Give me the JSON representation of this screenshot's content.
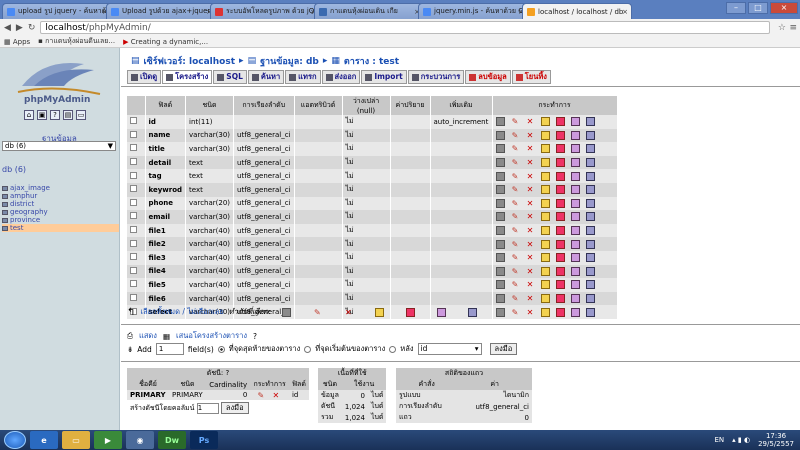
{
  "browser": {
    "tabs": [
      {
        "label": "upload รูป jquery - ค้นหาด้"
      },
      {
        "label": "Upload รูปด้วย ajax+jquer"
      },
      {
        "label": "ระบบอัพโหลดรูปภาพ ด้วย jQ"
      },
      {
        "label": "กาแดนหุ้งผ่อนเดิน เกีย"
      },
      {
        "label": "jquery.min.js - ค้นหาด้วย G"
      },
      {
        "label": "localhost / localhost / db"
      }
    ],
    "url_host": "localhost",
    "url_path": "/phpMyAdmin/",
    "bookmarks": [
      "Apps",
      "กาแดนหุ้งผ่อนดีนเลย...",
      "Creating a dynamic,..."
    ]
  },
  "sidebar": {
    "logo_text": "phpMyAdmin",
    "db_label": "ฐานข้อมูล",
    "db_select": "db (6)",
    "db_heading": "db (6)",
    "tables": [
      "ajax_image",
      "amphur",
      "district",
      "geography",
      "province",
      "test"
    ]
  },
  "breadcrumb": {
    "server": "เซิร์ฟเวอร์: localhost",
    "database": "ฐานข้อมูล: db",
    "table": "ตาราง : test"
  },
  "toolbar": {
    "browse": "เปิดดู",
    "structure": "โครงสร้าง",
    "sql": "SQL",
    "search": "ค้นหา",
    "insert": "แทรก",
    "export": "ส่งออก",
    "import": "Import",
    "operations": "กระบวนการ",
    "empty": "ลบข้อมูล",
    "drop": "โยนทิ้ง"
  },
  "structure": {
    "headers": [
      "ฟิลด์",
      "ชนิด",
      "การเรียงลำดับ",
      "แอตทริบิวต์",
      "ว่างเปล่า (null)",
      "ค่าปริยาย",
      "เพิ่มเติม",
      "กระทำการ"
    ],
    "rows": [
      {
        "field": "id",
        "type": "int(11)",
        "collation": "",
        "null": "ไม่",
        "extra": "auto_increment"
      },
      {
        "field": "name",
        "type": "varchar(30)",
        "collation": "utf8_general_ci",
        "null": "ไม่",
        "extra": ""
      },
      {
        "field": "title",
        "type": "varchar(30)",
        "collation": "utf8_general_ci",
        "null": "ไม่",
        "extra": ""
      },
      {
        "field": "detail",
        "type": "text",
        "collation": "utf8_general_ci",
        "null": "ไม่",
        "extra": ""
      },
      {
        "field": "tag",
        "type": "text",
        "collation": "utf8_general_ci",
        "null": "ไม่",
        "extra": ""
      },
      {
        "field": "keywrod",
        "type": "text",
        "collation": "utf8_general_ci",
        "null": "ไม่",
        "extra": ""
      },
      {
        "field": "phone",
        "type": "varchar(20)",
        "collation": "utf8_general_ci",
        "null": "ไม่",
        "extra": ""
      },
      {
        "field": "email",
        "type": "varchar(30)",
        "collation": "utf8_general_ci",
        "null": "ไม่",
        "extra": ""
      },
      {
        "field": "file1",
        "type": "varchar(40)",
        "collation": "utf8_general_ci",
        "null": "ไม่",
        "extra": ""
      },
      {
        "field": "file2",
        "type": "varchar(40)",
        "collation": "utf8_general_ci",
        "null": "ไม่",
        "extra": ""
      },
      {
        "field": "file3",
        "type": "varchar(40)",
        "collation": "utf8_general_ci",
        "null": "ไม่",
        "extra": ""
      },
      {
        "field": "file4",
        "type": "varchar(40)",
        "collation": "utf8_general_ci",
        "null": "ไม่",
        "extra": ""
      },
      {
        "field": "file5",
        "type": "varchar(40)",
        "collation": "utf8_general_ci",
        "null": "ไม่",
        "extra": ""
      },
      {
        "field": "file6",
        "type": "varchar(40)",
        "collation": "utf8_general_ci",
        "null": "ไม่",
        "extra": ""
      },
      {
        "field": "select",
        "type": "varchar(30)",
        "collation": "utf8_general_ci",
        "null": "ไม่",
        "extra": ""
      }
    ]
  },
  "selection": {
    "check_all": "เลือกทั้งหมด / ไม่เลือกเลย",
    "with_selected": "ทำกับที่เลือก:"
  },
  "print_links": {
    "print": "แสดง",
    "propose": "เสนอโครงสร้างตาราง"
  },
  "add_fields": {
    "label": "Add",
    "count": "1",
    "fields_label": "field(s)",
    "opt_end": "ที่จุดสุดท้ายของตาราง",
    "opt_begin": "ที่จุดเริ่มต้นของตาราง",
    "opt_after": "หลัง",
    "after_select": "id",
    "go": "ลงมือ"
  },
  "indexes": {
    "title": "ดัชนี:",
    "headers": [
      "ชื่อคีย์",
      "ชนิด",
      "Cardinality",
      "กระทำการ",
      "ฟิลด์"
    ],
    "row": {
      "key": "PRIMARY",
      "type": "PRIMARY",
      "card": "0",
      "field": "id"
    },
    "create_label": "สร้างดัชนีโดยคอลัมน์",
    "create_count": "1",
    "go": "ลงมือ"
  },
  "space": {
    "title": "เนื้อที่ที่ใช้",
    "headers": [
      "ชนิด",
      "ใช้งาน"
    ],
    "rows": [
      [
        "ข้อมูล",
        "0",
        "ไบต์"
      ],
      [
        "ดัชนี",
        "1,024",
        "ไบต์"
      ],
      [
        "รวม",
        "1,024",
        "ไบต์"
      ]
    ]
  },
  "stats": {
    "title": "สถิติของแถว",
    "headers": [
      "คำสั่ง",
      "ค่า"
    ],
    "rows": [
      [
        "รูปแบบ",
        "ไดนามิก"
      ],
      [
        "การเรียงลำดับ",
        "utf8_general_ci"
      ],
      [
        "แถว",
        "0"
      ]
    ]
  },
  "taskbar": {
    "lang": "EN",
    "time": "17:36",
    "date": "29/5/2557"
  }
}
